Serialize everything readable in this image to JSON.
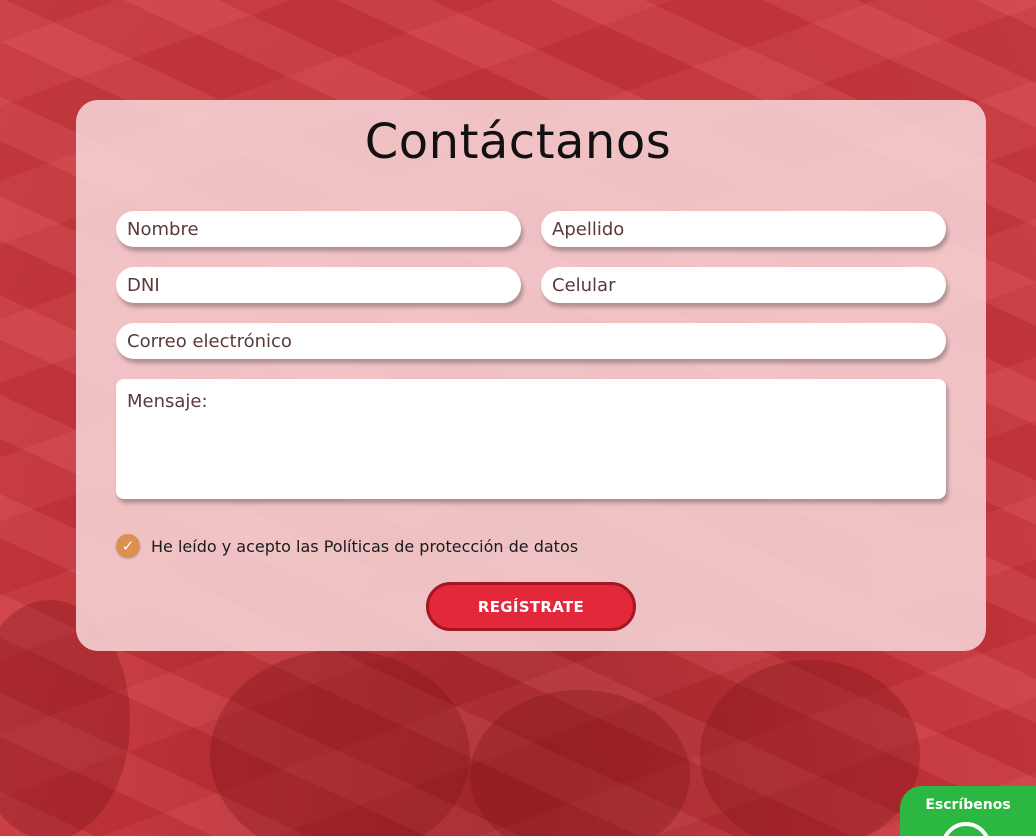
{
  "form": {
    "title": "Contáctanos",
    "fields": {
      "nombre_placeholder": "Nombre",
      "apellido_placeholder": "Apellido",
      "dni_placeholder": "DNI",
      "celular_placeholder": "Celular",
      "correo_placeholder": "Correo electrónico",
      "mensaje_placeholder": "Mensaje:"
    },
    "consent": {
      "checked": true,
      "label": "He leído y acepto las Políticas de protección de datos"
    },
    "submit_label": "REGÍSTRATE"
  },
  "whatsapp_widget": {
    "label": "Escríbenos",
    "icon": "whatsapp-icon"
  },
  "colors": {
    "background": "#c9343a",
    "card": "#f6d5d7",
    "button": "#e2283a",
    "button_border": "#a51522",
    "checkbox": "#dc8f4f",
    "whatsapp": "#2bb741"
  }
}
